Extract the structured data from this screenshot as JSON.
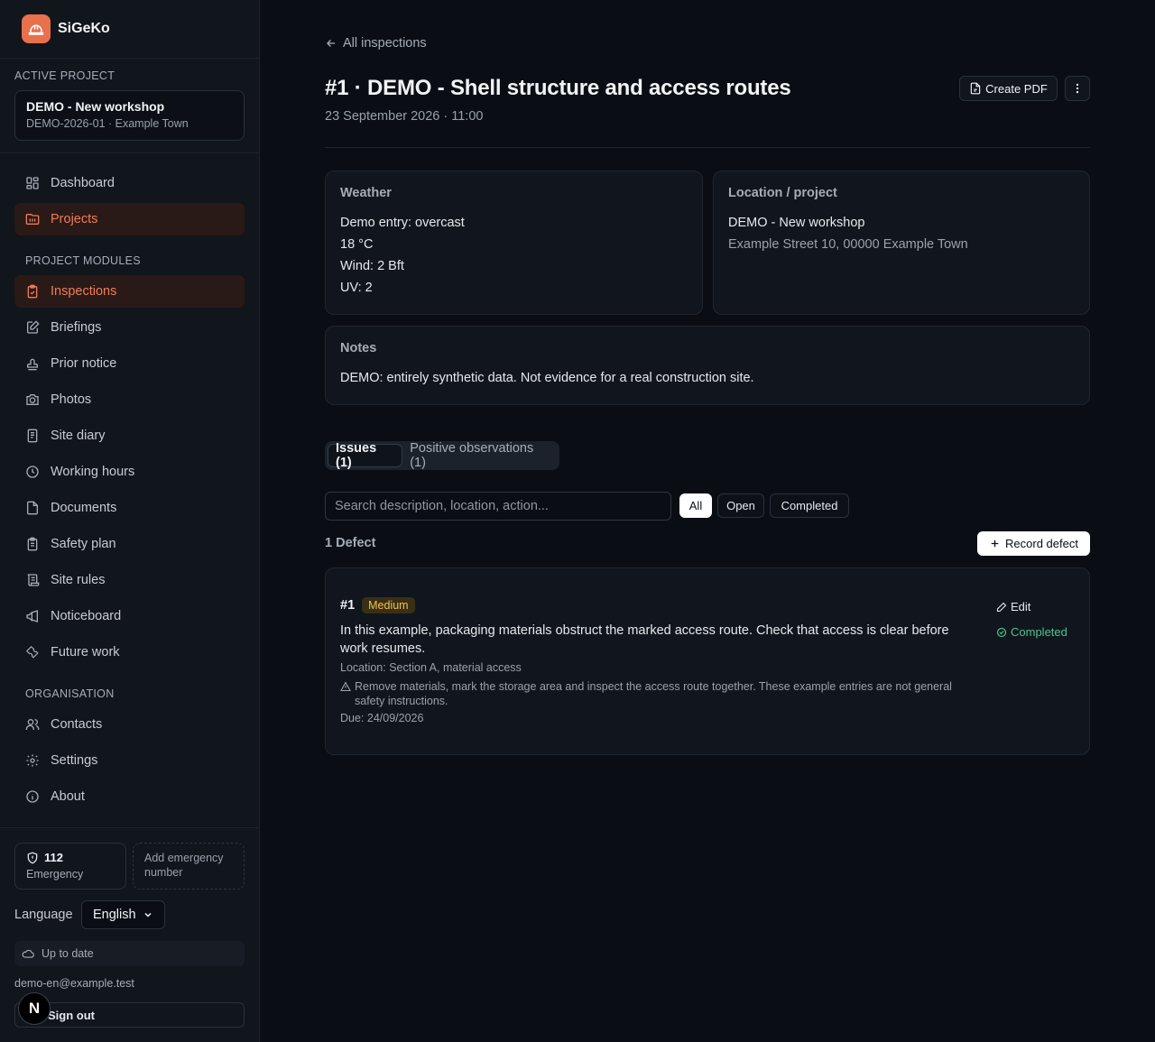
{
  "app": {
    "name": "SiGeKo"
  },
  "sidebar": {
    "active_project_label": "ACTIVE PROJECT",
    "project": {
      "name": "DEMO - New workshop",
      "sub": "DEMO-2026-01 · Example Town"
    },
    "main_items": [
      {
        "label": "Dashboard",
        "icon": "dashboard-icon"
      },
      {
        "label": "Projects",
        "icon": "folder-icon",
        "active": true
      }
    ],
    "modules_label": "PROJECT MODULES",
    "module_items": [
      {
        "label": "Inspections",
        "icon": "clipboard-check-icon",
        "active": true
      },
      {
        "label": "Briefings",
        "icon": "edit-document-icon"
      },
      {
        "label": "Prior notice",
        "icon": "stamp-icon"
      },
      {
        "label": "Photos",
        "icon": "camera-icon"
      },
      {
        "label": "Site diary",
        "icon": "notebook-icon"
      },
      {
        "label": "Working hours",
        "icon": "clock-icon"
      },
      {
        "label": "Documents",
        "icon": "file-icon"
      },
      {
        "label": "Safety plan",
        "icon": "clipboard-list-icon"
      },
      {
        "label": "Site rules",
        "icon": "scroll-icon"
      },
      {
        "label": "Noticeboard",
        "icon": "megaphone-icon"
      },
      {
        "label": "Future work",
        "icon": "wrench-icon"
      }
    ],
    "org_label": "ORGANISATION",
    "org_items": [
      {
        "label": "Contacts",
        "icon": "users-icon"
      },
      {
        "label": "Settings",
        "icon": "gear-icon"
      },
      {
        "label": "About",
        "icon": "info-icon"
      }
    ],
    "emergency": {
      "number": "112",
      "label": "Emergency"
    },
    "add_emergency": "Add emergency number",
    "language_label": "Language",
    "language_value": "English",
    "sync_status": "Up to date",
    "email": "demo-en@example.test",
    "signout_label": "Sign out",
    "badge_letter": "N"
  },
  "header": {
    "back_label": "All inspections",
    "title": "#1 · DEMO - Shell structure and access routes",
    "date": "23 September 2026 · 11:00",
    "pdf_label": "Create PDF"
  },
  "weather": {
    "title": "Weather",
    "lines": [
      "Demo entry: overcast",
      "18 °C",
      "Wind: 2 Bft",
      "UV: 2"
    ]
  },
  "location": {
    "title": "Location / project",
    "name": "DEMO - New workshop",
    "address": "Example Street 10, 00000 Example Town"
  },
  "notes": {
    "title": "Notes",
    "text": "DEMO: entirely synthetic data. Not evidence for a real construction site."
  },
  "tabs": [
    {
      "label": "Issues (1)",
      "active": true
    },
    {
      "label": "Positive observations (1)"
    }
  ],
  "search": {
    "placeholder": "Search description, location, action..."
  },
  "filters": [
    "All",
    "Open",
    "Completed"
  ],
  "defects": {
    "count_label": "1 Defect",
    "record_label": "Record defect",
    "items": [
      {
        "number": "#1",
        "severity": "Medium",
        "description": "In this example, packaging materials obstruct the marked access route. Check that access is clear before work resumes.",
        "location": "Location: Section A, material access",
        "action": "Remove materials, mark the storage area and inspect the access route together. These example entries are not general safety instructions.",
        "due": "Due: 24/09/2026",
        "edit_label": "Edit",
        "status": "Completed"
      }
    ]
  },
  "colors": {
    "accent": "#e8704d",
    "success": "#4cc38a",
    "warning": "#f2c14a",
    "background": "#0a0e14"
  }
}
